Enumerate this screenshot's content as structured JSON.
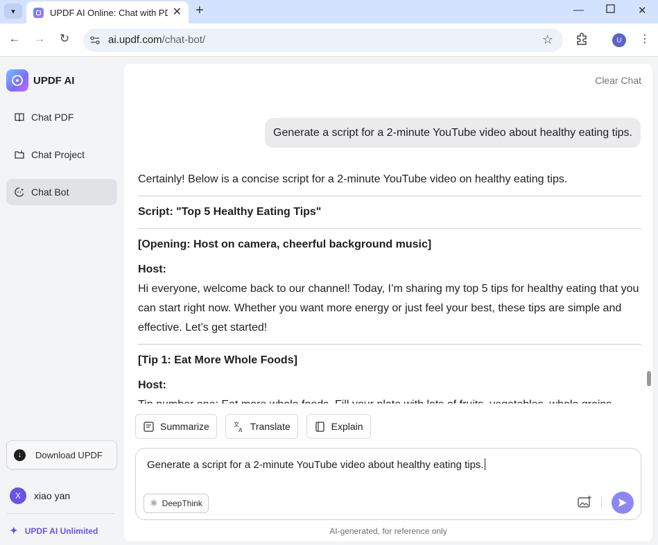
{
  "browser": {
    "tab_title": "UPDF AI Online: Chat with PDF",
    "url_host": "ai.updf.com",
    "url_path": "/chat-bot/",
    "profile_initial": "U"
  },
  "sidebar": {
    "brand": "UPDF AI",
    "items": [
      {
        "label": "Chat PDF",
        "icon": "book-icon"
      },
      {
        "label": "Chat Project",
        "icon": "folder-icon"
      },
      {
        "label": "Chat Bot",
        "icon": "bot-icon",
        "active": true
      }
    ],
    "download_label": "Download UPDF",
    "user_initial": "X",
    "user_name": "xiao yan",
    "unlimited_label": "UPDF AI Unlimited"
  },
  "chat": {
    "clear_label": "Clear Chat",
    "user_message": "Generate a script for a 2-minute YouTube video about healthy eating tips.",
    "answer": {
      "intro": "Certainly! Below is a concise script for a 2-minute YouTube video on healthy eating tips.",
      "script_title": "Script: \"Top 5 Healthy Eating Tips\"",
      "opening": "[Opening: Host on camera, cheerful background music]",
      "host_label_1": "Host:",
      "host_text_1": "Hi everyone, welcome back to our channel! Today, I’m sharing my top 5 tips for healthy eating that you can start right now. Whether you want more energy or just feel your best, these tips are simple and effective. Let’s get started!",
      "tip1": "[Tip 1: Eat More Whole Foods]",
      "host_label_2": "Host:",
      "host_text_2": "Tip number one: Eat more whole foods. Fill your plate with lots of fruits, vegetables, whole grains"
    },
    "actions": [
      {
        "label": "Summarize",
        "icon": "summarize-icon"
      },
      {
        "label": "Translate",
        "icon": "translate-icon"
      },
      {
        "label": "Explain",
        "icon": "book-icon"
      }
    ],
    "composer_value": "Generate a script for a 2-minute YouTube video about healthy eating tips.",
    "deepthink_label": "DeepThink",
    "disclaimer": "AI-generated, for reference only"
  },
  "colors": {
    "accent": "#6b52e8",
    "send": "#8f86f5",
    "tabstrip": "#d3e3fd"
  }
}
